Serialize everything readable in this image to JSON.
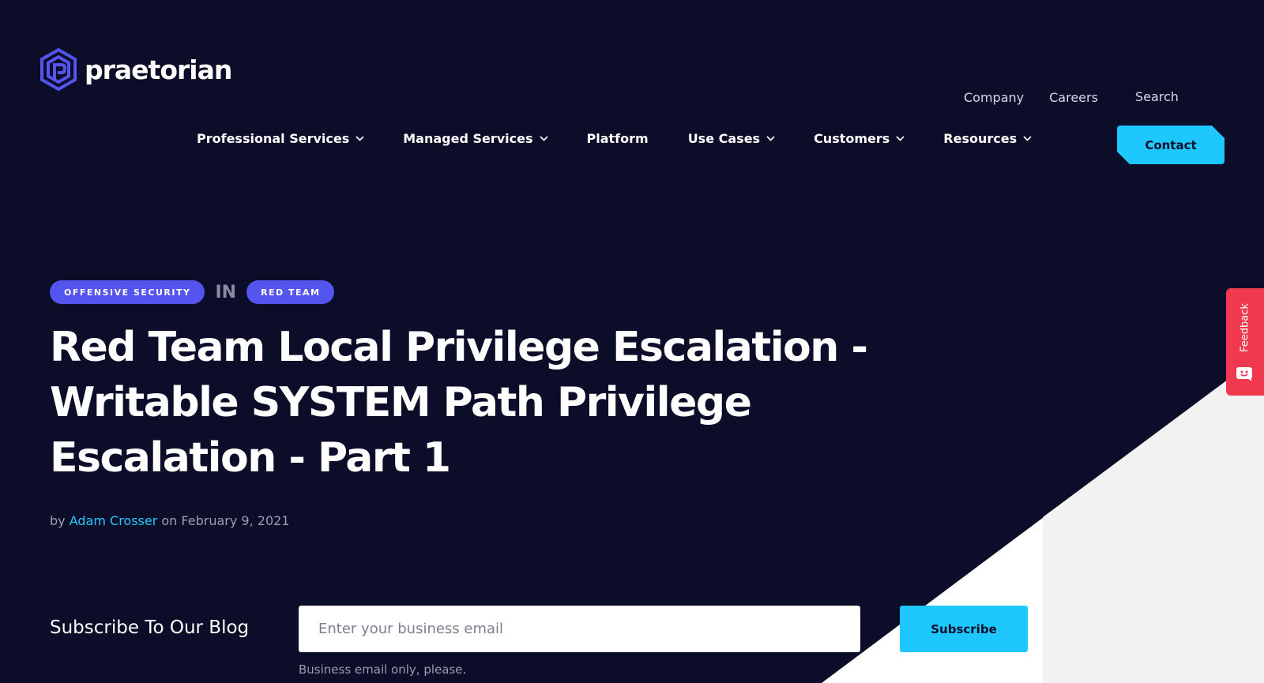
{
  "brand": {
    "logo_text": "praetorian",
    "accent": "#5454ee",
    "cyan": "#1ec8ff",
    "background": "#0c0d29"
  },
  "utility_nav": {
    "company": "Company",
    "careers": "Careers",
    "search": "Search"
  },
  "main_nav": {
    "items": [
      {
        "label": "Professional Services",
        "dropdown": true
      },
      {
        "label": "Managed Services",
        "dropdown": true
      },
      {
        "label": "Platform",
        "dropdown": false
      },
      {
        "label": "Use Cases",
        "dropdown": true
      },
      {
        "label": "Customers",
        "dropdown": true
      },
      {
        "label": "Resources",
        "dropdown": true
      }
    ],
    "contact": "Contact"
  },
  "article": {
    "category": "OFFENSIVE SECURITY",
    "in": "IN",
    "subcategory": "RED TEAM",
    "title": "Red Team Local Privilege Escalation - Writable SYSTEM Path Privilege Escalation - Part 1",
    "by": "by",
    "author": "Adam Crosser",
    "on": "on",
    "date": "February 9, 2021"
  },
  "subscribe": {
    "label": "Subscribe To Our Blog",
    "placeholder": "Enter your business email",
    "button": "Subscribe",
    "hint": "Business email only, please."
  },
  "feedback": {
    "label": "Feedback",
    "color": "#f0394f"
  }
}
